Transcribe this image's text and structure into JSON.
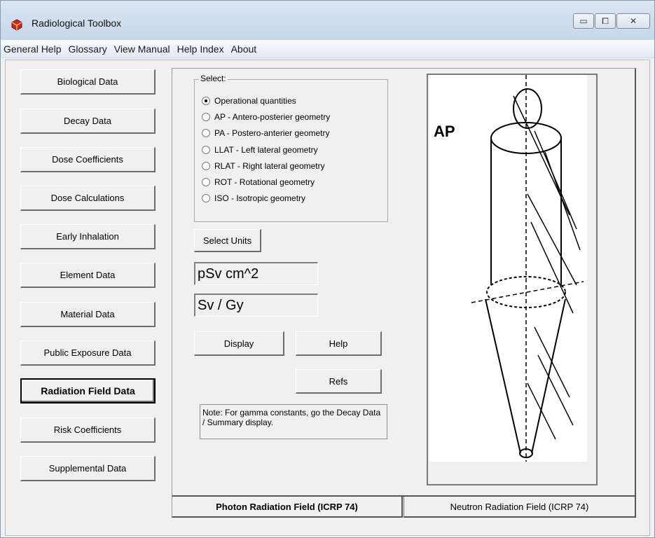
{
  "window": {
    "title": "Radiological Toolbox",
    "controls": {
      "minimize": "▭",
      "maximize": "⧠",
      "close": "✕"
    }
  },
  "menu": [
    "General Help",
    "Glossary",
    "View Manual",
    "Help Index",
    "About"
  ],
  "nav": [
    "Biological Data",
    "Decay Data",
    "Dose Coefficients",
    "Dose Calculations",
    "Early Inhalation",
    "Element Data",
    "Material Data",
    "Public Exposure Data",
    "Radiation Field Data",
    "Risk Coefficients",
    "Supplemental Data"
  ],
  "select": {
    "legend": "Select:",
    "options": [
      "Operational quantities",
      "AP  - Antero-posterier geometry",
      "PA - Postero-anterier geometry",
      "LLAT - Left lateral geometry",
      "RLAT - Right lateral geometry",
      "ROT - Rotational geometry",
      "ISO - Isotropic geometry"
    ],
    "selected": "Operational quantities"
  },
  "buttons": {
    "select_units": "Select Units",
    "display": "Display",
    "help": "Help",
    "refs": "Refs"
  },
  "units": {
    "unit1": "pSv  cm^2",
    "unit2": "Sv  /  Gy"
  },
  "note": "Note: For gamma constants, go the Decay Data / Summary display.",
  "figure_label": "AP",
  "tabs": [
    "Photon Radiation Field (ICRP 74)",
    "Neutron Radiation Field (ICRP 74)"
  ],
  "colors": {
    "titlebar": "#c7d6ea",
    "face": "#f0f0f0",
    "app_icon": "#cc2a1a"
  }
}
